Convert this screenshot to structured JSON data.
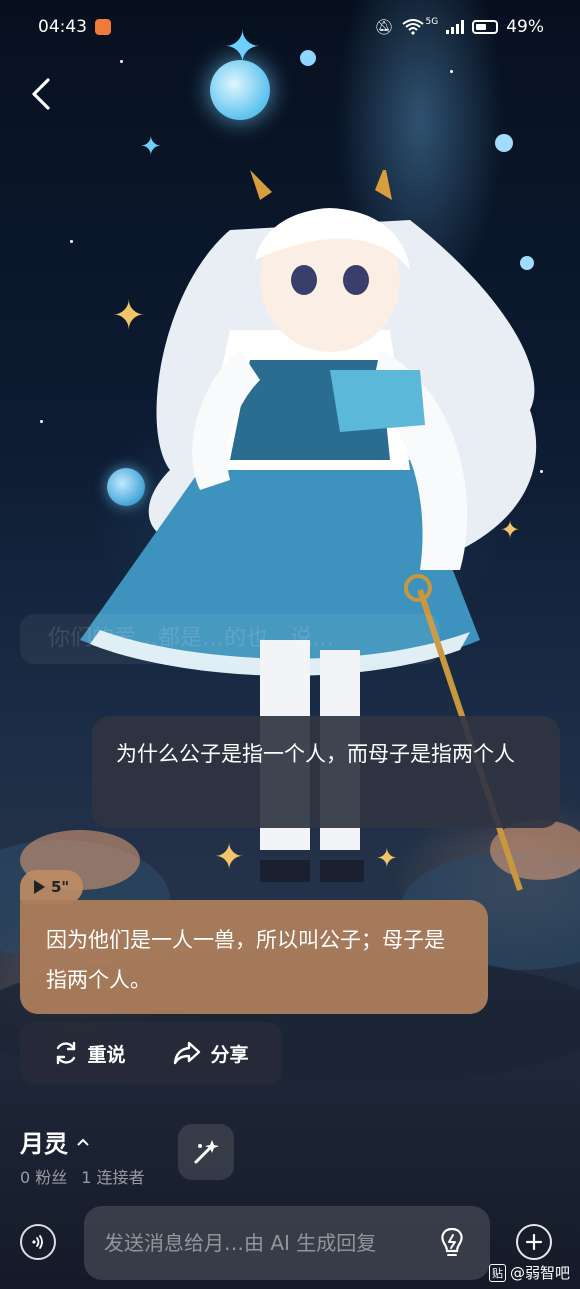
{
  "status_bar": {
    "time": "04:43",
    "network": "5G",
    "battery": "49%"
  },
  "faded_text": "你们的爱…都是…的也…说…",
  "chat": {
    "user_message": "为什么公子是指一个人，而母子是指两个人",
    "voice_duration": "5\"",
    "ai_message": "因为他们是一人一兽，所以叫公子；母子是指两个人。",
    "actions": {
      "retry": "重说",
      "share": "分享"
    }
  },
  "bot": {
    "name": "月灵",
    "followers": "0 粉丝",
    "connectors": "1 连接者"
  },
  "input": {
    "placeholder": "发送消息给月…由 AI 生成回复"
  },
  "watermark": "@弱智吧",
  "watermark_logo": "贴"
}
